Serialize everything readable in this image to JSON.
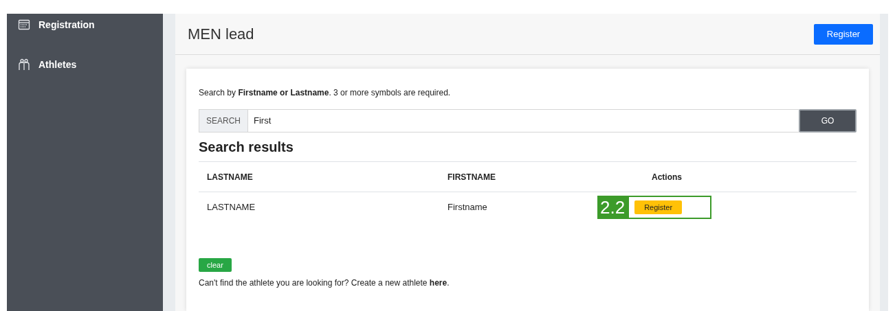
{
  "sidebar": {
    "items": [
      {
        "label": "Registration",
        "kind": "registration"
      },
      {
        "label": "Athletes",
        "kind": "athletes"
      }
    ]
  },
  "header": {
    "title": "MEN lead",
    "button": "Register"
  },
  "search": {
    "hint": "Search by **Firstname or Lastname**. 3 or more symbols are required.",
    "addon": "SEARCH",
    "value": "First",
    "button": "GO"
  },
  "results": {
    "title": "Search results",
    "columns": [
      "LASTNAME",
      "FIRSTNAME",
      "Actions"
    ],
    "rows": [
      {
        "lastname": "LASTNAME",
        "firstname": "Firstname",
        "action": "Register",
        "callout": "2.2"
      }
    ]
  },
  "clear_button": "clear",
  "footer": {
    "text": "Can't find the athlete you are looking for? Create a new athlete ",
    "link": "here",
    "end": "."
  }
}
